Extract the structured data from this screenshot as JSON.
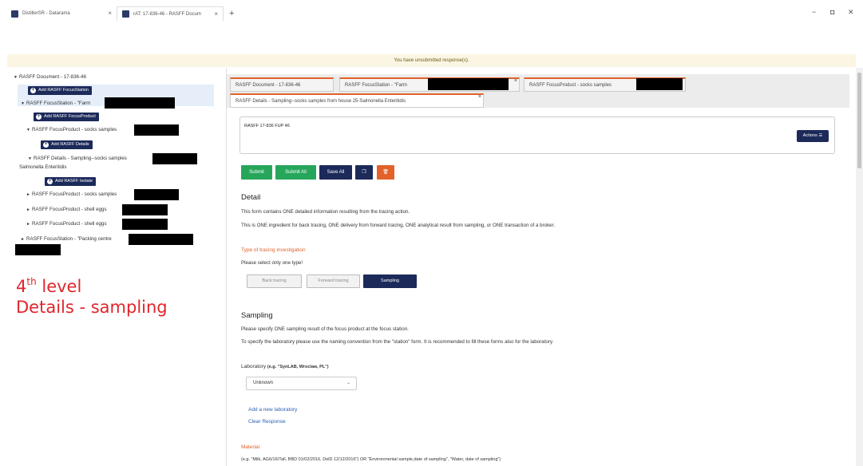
{
  "browser": {
    "tabs": [
      {
        "label": "DistillerSR - Datarama",
        "close": "×"
      },
      {
        "label": "rAT: 17-836-46 - RASFF Docum",
        "close": "×"
      }
    ],
    "new_tab": "+",
    "controls": {
      "minimize": "−",
      "maximize": "◘",
      "close": "✕"
    }
  },
  "banner": {
    "text": "You have unsubmitted response(s)."
  },
  "tree": {
    "nodes": [
      {
        "label": "RASFF Document - 17-836-46"
      },
      {
        "label": "RASFF FocusStation - \"Farm"
      },
      {
        "label": "RASFF FocusProduct - socks samples"
      },
      {
        "label": "RASFF Details - Sampling--socks samples"
      },
      {
        "label": "Salmonella Enteritidis"
      },
      {
        "label": "RASFF FocusProduct - socks samples"
      },
      {
        "label": "RASFF FocusProduct - shell eggs"
      },
      {
        "label": "RASFF FocusProduct - shell eggs"
      },
      {
        "label": "RASFF FocusStation - \"Packing centre"
      }
    ],
    "buttons": {
      "add_focus_station": "Add RASFF FocusStation",
      "add_focus_product": "Add RASFF FocusProduct",
      "add_details": "Add RASFF Details",
      "add_isolate": "Add RASFF Isolate"
    },
    "expanded_icon": "▼",
    "collapsed_icon": "►"
  },
  "annotation": {
    "ordinal": "4",
    "ordinal_sup": "th",
    "line1_rest": " level",
    "line2": "Details - sampling"
  },
  "doc_tabs": [
    {
      "label": "RASFF Document - 17-836-46"
    },
    {
      "label": "RASFF FocusStation - \"Farm"
    },
    {
      "label": "RASFF FocusProduct - socks samples"
    },
    {
      "label": "RASFF Details - Sampling--socks samples from house 25-Salmonella Enteritidis"
    }
  ],
  "tab_close": "×",
  "card": {
    "title": "RASFF 17-836 FUP 46",
    "actions": "Actions ☰"
  },
  "action_buttons": {
    "submit": "Submit",
    "submit_all": "Submit All",
    "save_all": "Save All",
    "copy_icon": "❐",
    "delete_icon": "🗑"
  },
  "detail": {
    "heading": "Detail",
    "line1": "This form contains ONE detailed information resulting from the tracing action.",
    "line2": "This is ONE ingredient for back tracing, ONE delivery from forward tracing, ONE analytical result from sampling, or ONE transaction of a broker."
  },
  "tracing": {
    "heading": "Type of tracing investigation",
    "hint": "Please select only one type!",
    "options": [
      "Back tracing",
      "Forward tracing",
      "Sampling"
    ],
    "selected": "Sampling"
  },
  "sampling": {
    "heading": "Sampling",
    "line1": "Please specify ONE sampling result of the focus product at the focus station.",
    "line2": "To specify the laboratory please use the naming convention from the \"station\" form. It is recommended to fill these forms also for the laboratory."
  },
  "laboratory": {
    "label": "Laboratory",
    "example": "(e.g. \"SynLAB, Wroclaw, PL\")",
    "value": "Unknown",
    "add_link": "Add a new laboratory",
    "clear_link": "Clear Response"
  },
  "material": {
    "heading": "Material",
    "example": "(e.g. \"Milk, AG6/16/TaF, BBD 01/02/2016, DelD 12/12/2016\") OR \"Environmental sample,date of sampling\", \"Water, date of sampling\")"
  },
  "colors": {
    "accent": "#e2622a",
    "navy": "#1c2a5a",
    "green": "#26a65b",
    "annotation": "#e0262c",
    "banner": "#fbf6e3"
  }
}
